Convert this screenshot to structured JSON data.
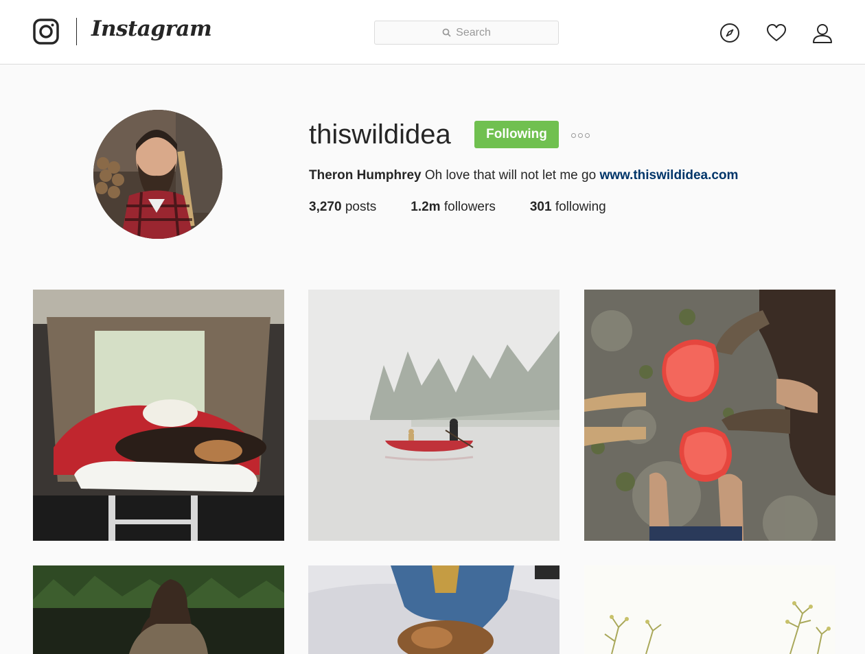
{
  "header": {
    "wordmark": "Instagram",
    "search": {
      "placeholder": "Search"
    },
    "icons": [
      "instagram-logo-icon",
      "compass-icon",
      "heart-icon",
      "user-icon"
    ]
  },
  "profile": {
    "username": "thiswildidea",
    "follow_button_label": "Following",
    "full_name": "Theron Humphrey",
    "bio_text": "Oh love that will not let me go",
    "website": "www.thiswildidea.com",
    "stats": {
      "posts_count": "3,270",
      "posts_label": "posts",
      "followers_count": "1.2m",
      "followers_label": "followers",
      "following_count": "301",
      "following_label": "following"
    }
  },
  "colors": {
    "follow_button": "#70c050",
    "link": "#003569",
    "background": "#fafafa"
  }
}
